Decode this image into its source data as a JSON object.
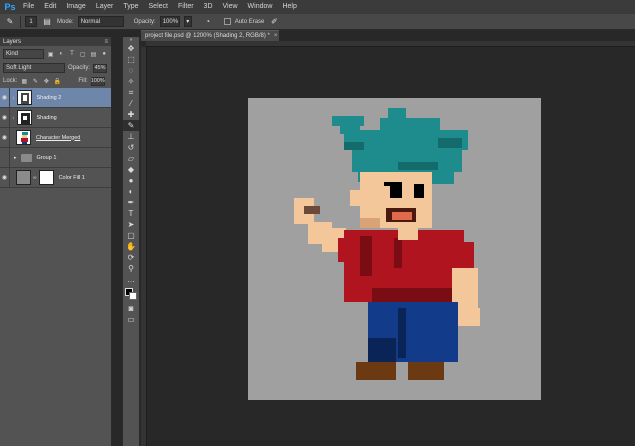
{
  "app": {
    "logo": "Ps"
  },
  "menu": [
    "File",
    "Edit",
    "Image",
    "Layer",
    "Type",
    "Select",
    "Filter",
    "3D",
    "View",
    "Window",
    "Help"
  ],
  "options": {
    "brush_size": "1",
    "mode_label": "Mode:",
    "mode_value": "Normal",
    "opacity_label": "Opacity:",
    "opacity_value": "100%",
    "auto_erase_label": "Auto Erase"
  },
  "layers_panel": {
    "tab_label": "Layers",
    "kind_value": "Kind",
    "blend_mode": "Soft Light",
    "opacity_label": "Opacity:",
    "opacity_value": "45%",
    "lock_label": "Lock:",
    "fill_label": "Fill:",
    "fill_value": "100%",
    "layers": [
      {
        "name": "Shading 2",
        "selected": true
      },
      {
        "name": "Shading"
      },
      {
        "name": "Character Merged"
      },
      {
        "name": "Group 1"
      },
      {
        "name": "Color Fill 1"
      }
    ]
  },
  "document": {
    "tab_title": "project file.psd @ 1200% (Shading 2, RGB/8) *",
    "close_glyph": "×"
  },
  "colors": {
    "canvas_bg": "#a0a0a0",
    "hair": "#1e8c8c",
    "skin": "#f3c79a",
    "shirt": "#b0141e",
    "pants": "#123c8a",
    "shoes": "#6b3a12"
  }
}
